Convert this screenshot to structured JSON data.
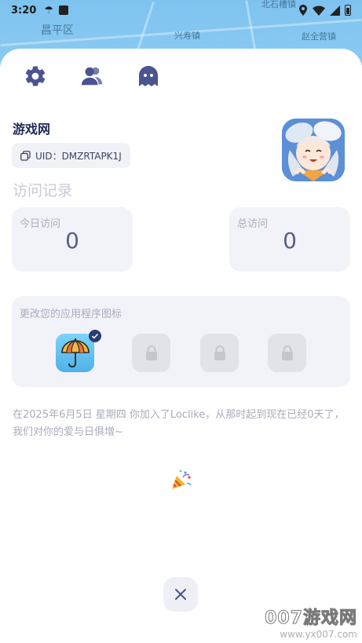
{
  "status_bar": {
    "time": "3:20"
  },
  "map": {
    "labels": [
      "昌平区",
      "兴寿镇",
      "赵全营镇",
      "北石槽镇"
    ]
  },
  "app": {
    "name": "游戏网",
    "uid_label": "UID：DMZRTAPK1J"
  },
  "visits": {
    "title": "访问记录",
    "today_label": "今日访问",
    "today_value": "0",
    "total_label": "总访问",
    "total_value": "0"
  },
  "icon_picker": {
    "title": "更改您的应用程序图标",
    "icons": [
      {
        "name": "umbrella-icon",
        "selected": true,
        "locked": false
      },
      {
        "name": "lock-icon",
        "selected": false,
        "locked": true
      },
      {
        "name": "lock-icon",
        "selected": false,
        "locked": true
      },
      {
        "name": "lock-icon",
        "selected": false,
        "locked": true
      }
    ]
  },
  "join_message": "在2025年6月5日 星期四 你加入了Loclike，从那时起到现在已经0天了，我们对你的爱与日俱增~",
  "watermark": {
    "line1": "007游戏网",
    "line2": "www.yx007.com"
  },
  "colors": {
    "accent": "#4a5490",
    "card_bg": "#f2f3f8",
    "text_muted": "#a9acbd"
  }
}
